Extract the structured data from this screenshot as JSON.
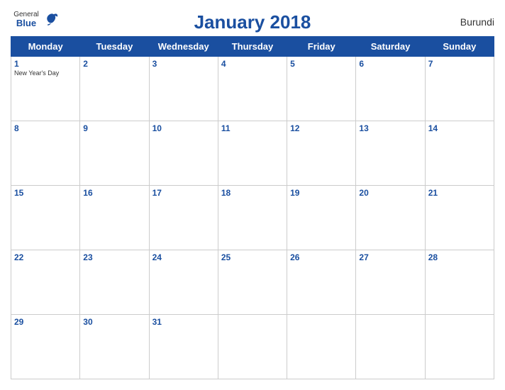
{
  "header": {
    "logo": {
      "general": "General",
      "blue": "Blue"
    },
    "title": "January 2018",
    "country": "Burundi"
  },
  "days_of_week": [
    "Monday",
    "Tuesday",
    "Wednesday",
    "Thursday",
    "Friday",
    "Saturday",
    "Sunday"
  ],
  "weeks": [
    [
      {
        "day": "1",
        "holiday": "New Year's Day"
      },
      {
        "day": "2"
      },
      {
        "day": "3"
      },
      {
        "day": "4"
      },
      {
        "day": "5"
      },
      {
        "day": "6"
      },
      {
        "day": "7"
      }
    ],
    [
      {
        "day": "8"
      },
      {
        "day": "9"
      },
      {
        "day": "10"
      },
      {
        "day": "11"
      },
      {
        "day": "12"
      },
      {
        "day": "13"
      },
      {
        "day": "14"
      }
    ],
    [
      {
        "day": "15"
      },
      {
        "day": "16"
      },
      {
        "day": "17"
      },
      {
        "day": "18"
      },
      {
        "day": "19"
      },
      {
        "day": "20"
      },
      {
        "day": "21"
      }
    ],
    [
      {
        "day": "22"
      },
      {
        "day": "23"
      },
      {
        "day": "24"
      },
      {
        "day": "25"
      },
      {
        "day": "26"
      },
      {
        "day": "27"
      },
      {
        "day": "28"
      }
    ],
    [
      {
        "day": "29"
      },
      {
        "day": "30"
      },
      {
        "day": "31"
      },
      {
        "day": "",
        "empty": true
      },
      {
        "day": "",
        "empty": true
      },
      {
        "day": "",
        "empty": true
      },
      {
        "day": "",
        "empty": true
      }
    ]
  ]
}
